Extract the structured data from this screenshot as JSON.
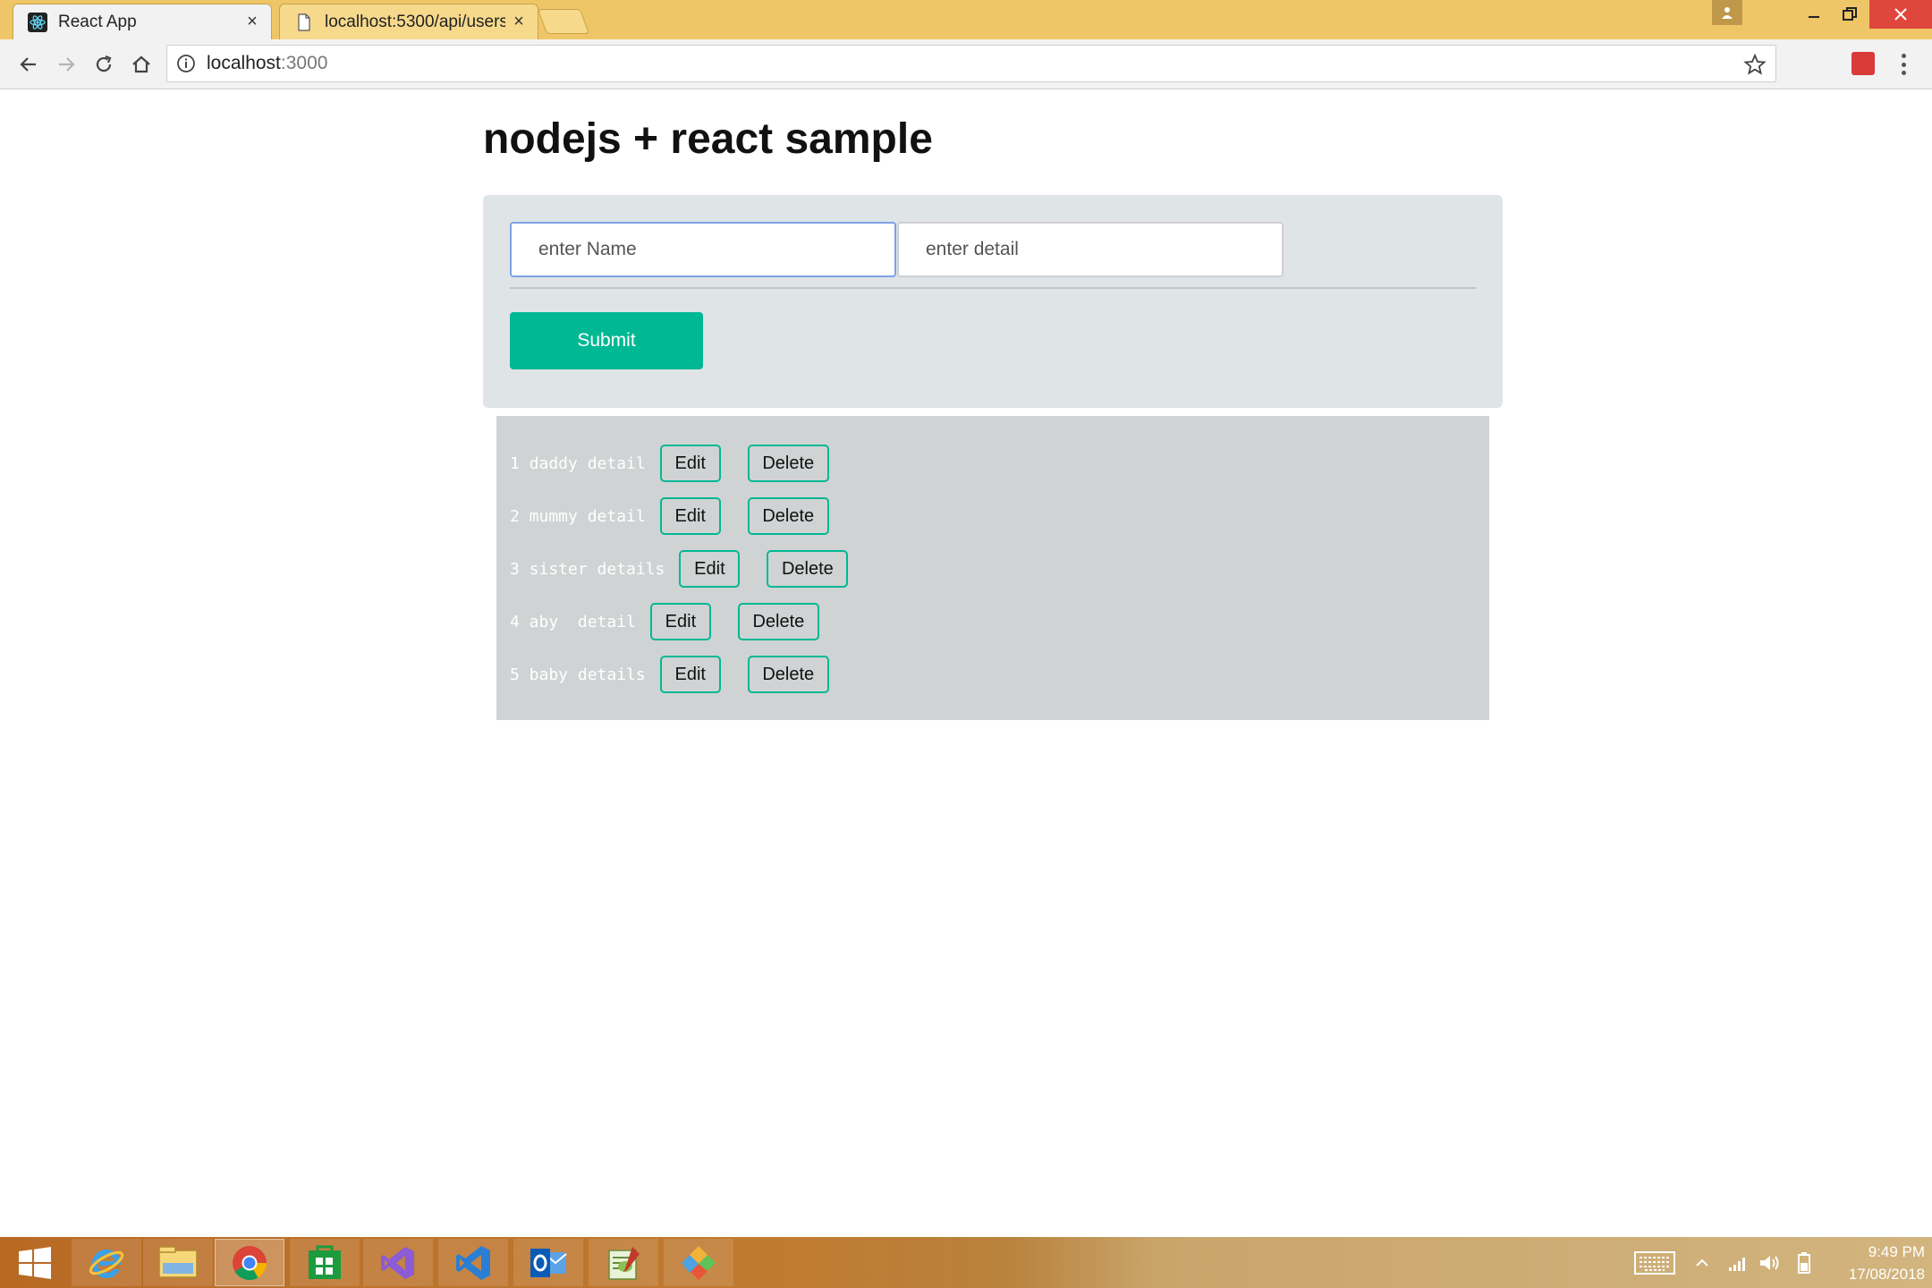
{
  "browser": {
    "tabs": [
      {
        "title": "React App",
        "icon": "react-icon",
        "close": "×"
      },
      {
        "title": "localhost:5300/api/users",
        "icon": "page-icon",
        "close": "×"
      }
    ],
    "url_host": "localhost",
    "url_port": ":3000"
  },
  "page": {
    "title": "nodejs + react sample",
    "name_placeholder": "enter Name",
    "detail_placeholder": "enter detail",
    "submit_label": "Submit",
    "items": [
      {
        "text": "1 daddy detail",
        "edit": "Edit",
        "delete": "Delete"
      },
      {
        "text": "2 mummy detail",
        "edit": "Edit",
        "delete": "Delete"
      },
      {
        "text": "3 sister details",
        "edit": "Edit",
        "delete": "Delete"
      },
      {
        "text": "4 aby  detail",
        "edit": "Edit",
        "delete": "Delete"
      },
      {
        "text": "5 baby details",
        "edit": "Edit",
        "delete": "Delete"
      }
    ]
  },
  "taskbar": {
    "apps": [
      "start-icon",
      "internet-explorer-icon",
      "file-explorer-icon",
      "chrome-icon",
      "store-icon",
      "visual-studio-icon",
      "vscode-icon",
      "outlook-icon",
      "notepad-plus-plus-icon",
      "git-icon"
    ],
    "time": "9:49 PM",
    "date": "17/08/2018"
  },
  "colors": {
    "accent": "#00b894",
    "titlebar": "#efc667",
    "form_card": "#dfe4e7",
    "list_panel": "#d0d3d4"
  }
}
